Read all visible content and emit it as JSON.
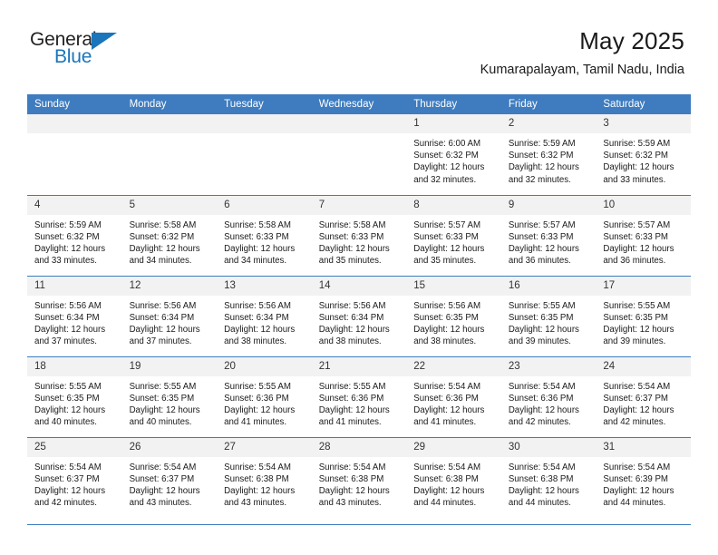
{
  "brand": {
    "name_part1": "General",
    "name_part2": "Blue",
    "logo_icon": "triangle-logo-icon"
  },
  "header": {
    "title": "May 2025",
    "subtitle": "Kumarapalayam, Tamil Nadu, India"
  },
  "calendar": {
    "weekdays": [
      "Sunday",
      "Monday",
      "Tuesday",
      "Wednesday",
      "Thursday",
      "Friday",
      "Saturday"
    ],
    "accent_color": "#3e7cbf",
    "daynum_bg": "#f2f2f2",
    "weeks": [
      [
        {
          "day": "",
          "empty": true
        },
        {
          "day": "",
          "empty": true
        },
        {
          "day": "",
          "empty": true
        },
        {
          "day": "",
          "empty": true
        },
        {
          "day": "1",
          "sunrise": "Sunrise: 6:00 AM",
          "sunset": "Sunset: 6:32 PM",
          "daylight1": "Daylight: 12 hours",
          "daylight2": "and 32 minutes."
        },
        {
          "day": "2",
          "sunrise": "Sunrise: 5:59 AM",
          "sunset": "Sunset: 6:32 PM",
          "daylight1": "Daylight: 12 hours",
          "daylight2": "and 32 minutes."
        },
        {
          "day": "3",
          "sunrise": "Sunrise: 5:59 AM",
          "sunset": "Sunset: 6:32 PM",
          "daylight1": "Daylight: 12 hours",
          "daylight2": "and 33 minutes."
        }
      ],
      [
        {
          "day": "4",
          "sunrise": "Sunrise: 5:59 AM",
          "sunset": "Sunset: 6:32 PM",
          "daylight1": "Daylight: 12 hours",
          "daylight2": "and 33 minutes."
        },
        {
          "day": "5",
          "sunrise": "Sunrise: 5:58 AM",
          "sunset": "Sunset: 6:32 PM",
          "daylight1": "Daylight: 12 hours",
          "daylight2": "and 34 minutes."
        },
        {
          "day": "6",
          "sunrise": "Sunrise: 5:58 AM",
          "sunset": "Sunset: 6:33 PM",
          "daylight1": "Daylight: 12 hours",
          "daylight2": "and 34 minutes."
        },
        {
          "day": "7",
          "sunrise": "Sunrise: 5:58 AM",
          "sunset": "Sunset: 6:33 PM",
          "daylight1": "Daylight: 12 hours",
          "daylight2": "and 35 minutes."
        },
        {
          "day": "8",
          "sunrise": "Sunrise: 5:57 AM",
          "sunset": "Sunset: 6:33 PM",
          "daylight1": "Daylight: 12 hours",
          "daylight2": "and 35 minutes."
        },
        {
          "day": "9",
          "sunrise": "Sunrise: 5:57 AM",
          "sunset": "Sunset: 6:33 PM",
          "daylight1": "Daylight: 12 hours",
          "daylight2": "and 36 minutes."
        },
        {
          "day": "10",
          "sunrise": "Sunrise: 5:57 AM",
          "sunset": "Sunset: 6:33 PM",
          "daylight1": "Daylight: 12 hours",
          "daylight2": "and 36 minutes."
        }
      ],
      [
        {
          "day": "11",
          "sunrise": "Sunrise: 5:56 AM",
          "sunset": "Sunset: 6:34 PM",
          "daylight1": "Daylight: 12 hours",
          "daylight2": "and 37 minutes."
        },
        {
          "day": "12",
          "sunrise": "Sunrise: 5:56 AM",
          "sunset": "Sunset: 6:34 PM",
          "daylight1": "Daylight: 12 hours",
          "daylight2": "and 37 minutes."
        },
        {
          "day": "13",
          "sunrise": "Sunrise: 5:56 AM",
          "sunset": "Sunset: 6:34 PM",
          "daylight1": "Daylight: 12 hours",
          "daylight2": "and 38 minutes."
        },
        {
          "day": "14",
          "sunrise": "Sunrise: 5:56 AM",
          "sunset": "Sunset: 6:34 PM",
          "daylight1": "Daylight: 12 hours",
          "daylight2": "and 38 minutes."
        },
        {
          "day": "15",
          "sunrise": "Sunrise: 5:56 AM",
          "sunset": "Sunset: 6:35 PM",
          "daylight1": "Daylight: 12 hours",
          "daylight2": "and 38 minutes."
        },
        {
          "day": "16",
          "sunrise": "Sunrise: 5:55 AM",
          "sunset": "Sunset: 6:35 PM",
          "daylight1": "Daylight: 12 hours",
          "daylight2": "and 39 minutes."
        },
        {
          "day": "17",
          "sunrise": "Sunrise: 5:55 AM",
          "sunset": "Sunset: 6:35 PM",
          "daylight1": "Daylight: 12 hours",
          "daylight2": "and 39 minutes."
        }
      ],
      [
        {
          "day": "18",
          "sunrise": "Sunrise: 5:55 AM",
          "sunset": "Sunset: 6:35 PM",
          "daylight1": "Daylight: 12 hours",
          "daylight2": "and 40 minutes."
        },
        {
          "day": "19",
          "sunrise": "Sunrise: 5:55 AM",
          "sunset": "Sunset: 6:35 PM",
          "daylight1": "Daylight: 12 hours",
          "daylight2": "and 40 minutes."
        },
        {
          "day": "20",
          "sunrise": "Sunrise: 5:55 AM",
          "sunset": "Sunset: 6:36 PM",
          "daylight1": "Daylight: 12 hours",
          "daylight2": "and 41 minutes."
        },
        {
          "day": "21",
          "sunrise": "Sunrise: 5:55 AM",
          "sunset": "Sunset: 6:36 PM",
          "daylight1": "Daylight: 12 hours",
          "daylight2": "and 41 minutes."
        },
        {
          "day": "22",
          "sunrise": "Sunrise: 5:54 AM",
          "sunset": "Sunset: 6:36 PM",
          "daylight1": "Daylight: 12 hours",
          "daylight2": "and 41 minutes."
        },
        {
          "day": "23",
          "sunrise": "Sunrise: 5:54 AM",
          "sunset": "Sunset: 6:36 PM",
          "daylight1": "Daylight: 12 hours",
          "daylight2": "and 42 minutes."
        },
        {
          "day": "24",
          "sunrise": "Sunrise: 5:54 AM",
          "sunset": "Sunset: 6:37 PM",
          "daylight1": "Daylight: 12 hours",
          "daylight2": "and 42 minutes."
        }
      ],
      [
        {
          "day": "25",
          "sunrise": "Sunrise: 5:54 AM",
          "sunset": "Sunset: 6:37 PM",
          "daylight1": "Daylight: 12 hours",
          "daylight2": "and 42 minutes."
        },
        {
          "day": "26",
          "sunrise": "Sunrise: 5:54 AM",
          "sunset": "Sunset: 6:37 PM",
          "daylight1": "Daylight: 12 hours",
          "daylight2": "and 43 minutes."
        },
        {
          "day": "27",
          "sunrise": "Sunrise: 5:54 AM",
          "sunset": "Sunset: 6:38 PM",
          "daylight1": "Daylight: 12 hours",
          "daylight2": "and 43 minutes."
        },
        {
          "day": "28",
          "sunrise": "Sunrise: 5:54 AM",
          "sunset": "Sunset: 6:38 PM",
          "daylight1": "Daylight: 12 hours",
          "daylight2": "and 43 minutes."
        },
        {
          "day": "29",
          "sunrise": "Sunrise: 5:54 AM",
          "sunset": "Sunset: 6:38 PM",
          "daylight1": "Daylight: 12 hours",
          "daylight2": "and 44 minutes."
        },
        {
          "day": "30",
          "sunrise": "Sunrise: 5:54 AM",
          "sunset": "Sunset: 6:38 PM",
          "daylight1": "Daylight: 12 hours",
          "daylight2": "and 44 minutes."
        },
        {
          "day": "31",
          "sunrise": "Sunrise: 5:54 AM",
          "sunset": "Sunset: 6:39 PM",
          "daylight1": "Daylight: 12 hours",
          "daylight2": "and 44 minutes."
        }
      ]
    ]
  }
}
